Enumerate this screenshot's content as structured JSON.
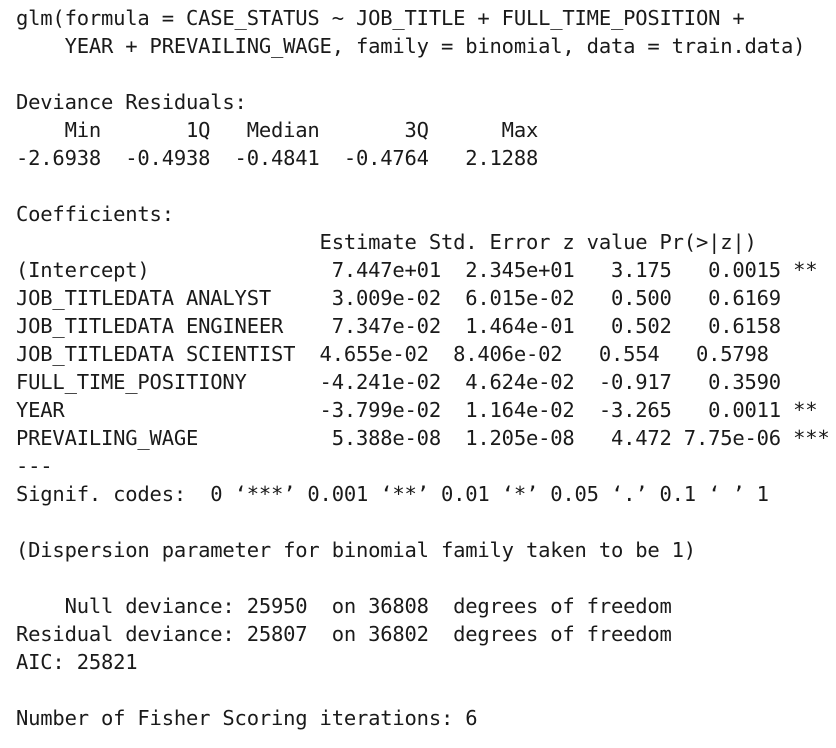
{
  "console": {
    "call_line_1": "glm(formula = CASE_STATUS ~ JOB_TITLE + FULL_TIME_POSITION +",
    "call_line_2": "    YEAR + PREVAILING_WAGE, family = binomial, data = train.data)",
    "deviance_header": "Deviance Residuals:",
    "deviance_labels_row": "    Min       1Q   Median       3Q      Max",
    "deviance_values_row": "-2.6938  -0.4938  -0.4841  -0.4764   2.1288",
    "coefficients_header": "Coefficients:",
    "coef_column_header": "                         Estimate Std. Error z value Pr(>|z|)",
    "coef_rows": [
      "(Intercept)               7.447e+01  2.345e+01   3.175   0.0015 **",
      "JOB_TITLEDATA ANALYST     3.009e-02  6.015e-02   0.500   0.6169",
      "JOB_TITLEDATA ENGINEER    7.347e-02  1.464e-01   0.502   0.6158",
      "JOB_TITLEDATA SCIENTIST  4.655e-02  8.406e-02   0.554   0.5798",
      "FULL_TIME_POSITIONY      -4.241e-02  4.624e-02  -0.917   0.3590",
      "YEAR                     -3.799e-02  1.164e-02  -3.265   0.0011 **",
      "PREVAILING_WAGE           5.388e-08  1.205e-08   4.472 7.75e-06 ***"
    ],
    "separator": "---",
    "signif_codes": "Signif. codes:  0 ‘***’ 0.001 ‘**’ 0.01 ‘*’ 0.05 ‘.’ 0.1 ‘ ’ 1",
    "dispersion_note": "(Dispersion parameter for binomial family taken to be 1)",
    "null_deviance": "    Null deviance: 25950  on 36808  degrees of freedom",
    "residual_deviance": "Residual deviance: 25807  on 36802  degrees of freedom",
    "aic": "AIC: 25821",
    "fisher_iterations": "Number of Fisher Scoring iterations: 6"
  }
}
